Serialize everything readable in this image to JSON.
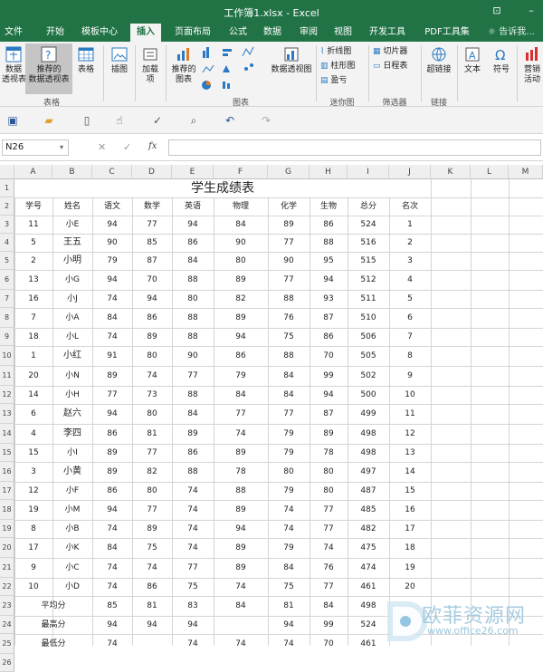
{
  "window": {
    "title": "工作簿1.xlsx - Excel"
  },
  "tabs": [
    "文件",
    "开始",
    "模板中心",
    "插入",
    "页面布局",
    "公式",
    "数据",
    "审阅",
    "视图",
    "开发工具",
    "PDF工具集"
  ],
  "tell_me": "告诉我...",
  "ribbon": {
    "pivot": "数据\n透视表",
    "rec_pivot": "推荐的\n数据透视表",
    "table": "表格",
    "illustrations": "插图",
    "addins": "加载\n项",
    "rec_charts": "推荐的\n图表",
    "pivot_chart": "数据透视图",
    "spark_line": "折线图",
    "spark_col": "柱形图",
    "spark_wl": "盈亏",
    "slicer": "切片器",
    "timeline": "日程表",
    "hyperlink": "超链接",
    "text": "文本",
    "symbol": "符号",
    "marketing": "营销\n活动",
    "groups": {
      "tables": "表格",
      "charts": "图表",
      "sparklines": "迷你图",
      "filters": "筛选器",
      "links": "链接"
    }
  },
  "formula_bar": {
    "name_box": "N26",
    "formula": ""
  },
  "columns": [
    "A",
    "B",
    "C",
    "D",
    "E",
    "F",
    "G",
    "H",
    "I",
    "J",
    "K",
    "L",
    "M"
  ],
  "sheet": {
    "title": "学生成绩表",
    "headers": [
      "学号",
      "姓名",
      "语文",
      "数学",
      "英语",
      "物理",
      "化学",
      "生物",
      "总分",
      "名次"
    ],
    "rows": [
      [
        "11",
        "小E",
        "94",
        "77",
        "94",
        "84",
        "89",
        "86",
        "524",
        "1"
      ],
      [
        "5",
        "王五",
        "90",
        "85",
        "86",
        "90",
        "77",
        "88",
        "516",
        "2"
      ],
      [
        "2",
        "小明",
        "79",
        "87",
        "84",
        "80",
        "90",
        "95",
        "515",
        "3"
      ],
      [
        "13",
        "小G",
        "94",
        "70",
        "88",
        "89",
        "77",
        "94",
        "512",
        "4"
      ],
      [
        "16",
        "小J",
        "74",
        "94",
        "80",
        "82",
        "88",
        "93",
        "511",
        "5"
      ],
      [
        "7",
        "小A",
        "84",
        "86",
        "88",
        "89",
        "76",
        "87",
        "510",
        "6"
      ],
      [
        "18",
        "小L",
        "74",
        "89",
        "88",
        "94",
        "75",
        "86",
        "506",
        "7"
      ],
      [
        "1",
        "小红",
        "91",
        "80",
        "90",
        "86",
        "88",
        "70",
        "505",
        "8"
      ],
      [
        "20",
        "小N",
        "89",
        "74",
        "77",
        "79",
        "84",
        "99",
        "502",
        "9"
      ],
      [
        "14",
        "小H",
        "77",
        "73",
        "88",
        "84",
        "84",
        "94",
        "500",
        "10"
      ],
      [
        "6",
        "赵六",
        "94",
        "80",
        "84",
        "77",
        "77",
        "87",
        "499",
        "11"
      ],
      [
        "4",
        "李四",
        "86",
        "81",
        "89",
        "74",
        "79",
        "89",
        "498",
        "12"
      ],
      [
        "15",
        "小I",
        "89",
        "77",
        "86",
        "89",
        "79",
        "78",
        "498",
        "13"
      ],
      [
        "3",
        "小黄",
        "89",
        "82",
        "88",
        "78",
        "80",
        "80",
        "497",
        "14"
      ],
      [
        "12",
        "小F",
        "86",
        "80",
        "74",
        "88",
        "79",
        "80",
        "487",
        "15"
      ],
      [
        "19",
        "小M",
        "94",
        "77",
        "74",
        "89",
        "74",
        "77",
        "485",
        "16"
      ],
      [
        "8",
        "小B",
        "74",
        "89",
        "74",
        "94",
        "74",
        "77",
        "482",
        "17"
      ],
      [
        "17",
        "小K",
        "84",
        "75",
        "74",
        "89",
        "79",
        "74",
        "475",
        "18"
      ],
      [
        "9",
        "小C",
        "74",
        "74",
        "77",
        "89",
        "84",
        "76",
        "474",
        "19"
      ],
      [
        "10",
        "小D",
        "74",
        "86",
        "75",
        "74",
        "75",
        "77",
        "461",
        "20"
      ]
    ],
    "summary": [
      {
        "label": "平均分",
        "values": [
          "85",
          "81",
          "83",
          "84",
          "81",
          "84",
          "498"
        ]
      },
      {
        "label": "最高分",
        "values": [
          "94",
          "94",
          "94",
          "",
          "94",
          "99",
          "524"
        ]
      },
      {
        "label": "最低分",
        "values": [
          "74",
          "",
          "74",
          "74",
          "74",
          "70",
          "461"
        ]
      }
    ]
  },
  "watermark": {
    "brand": "欧菲资源网",
    "url": "www.office26.com"
  },
  "colors": {
    "excel_green": "#217346",
    "ribbon_bg": "#f3f3f3",
    "grid": "#d4d4d4"
  }
}
